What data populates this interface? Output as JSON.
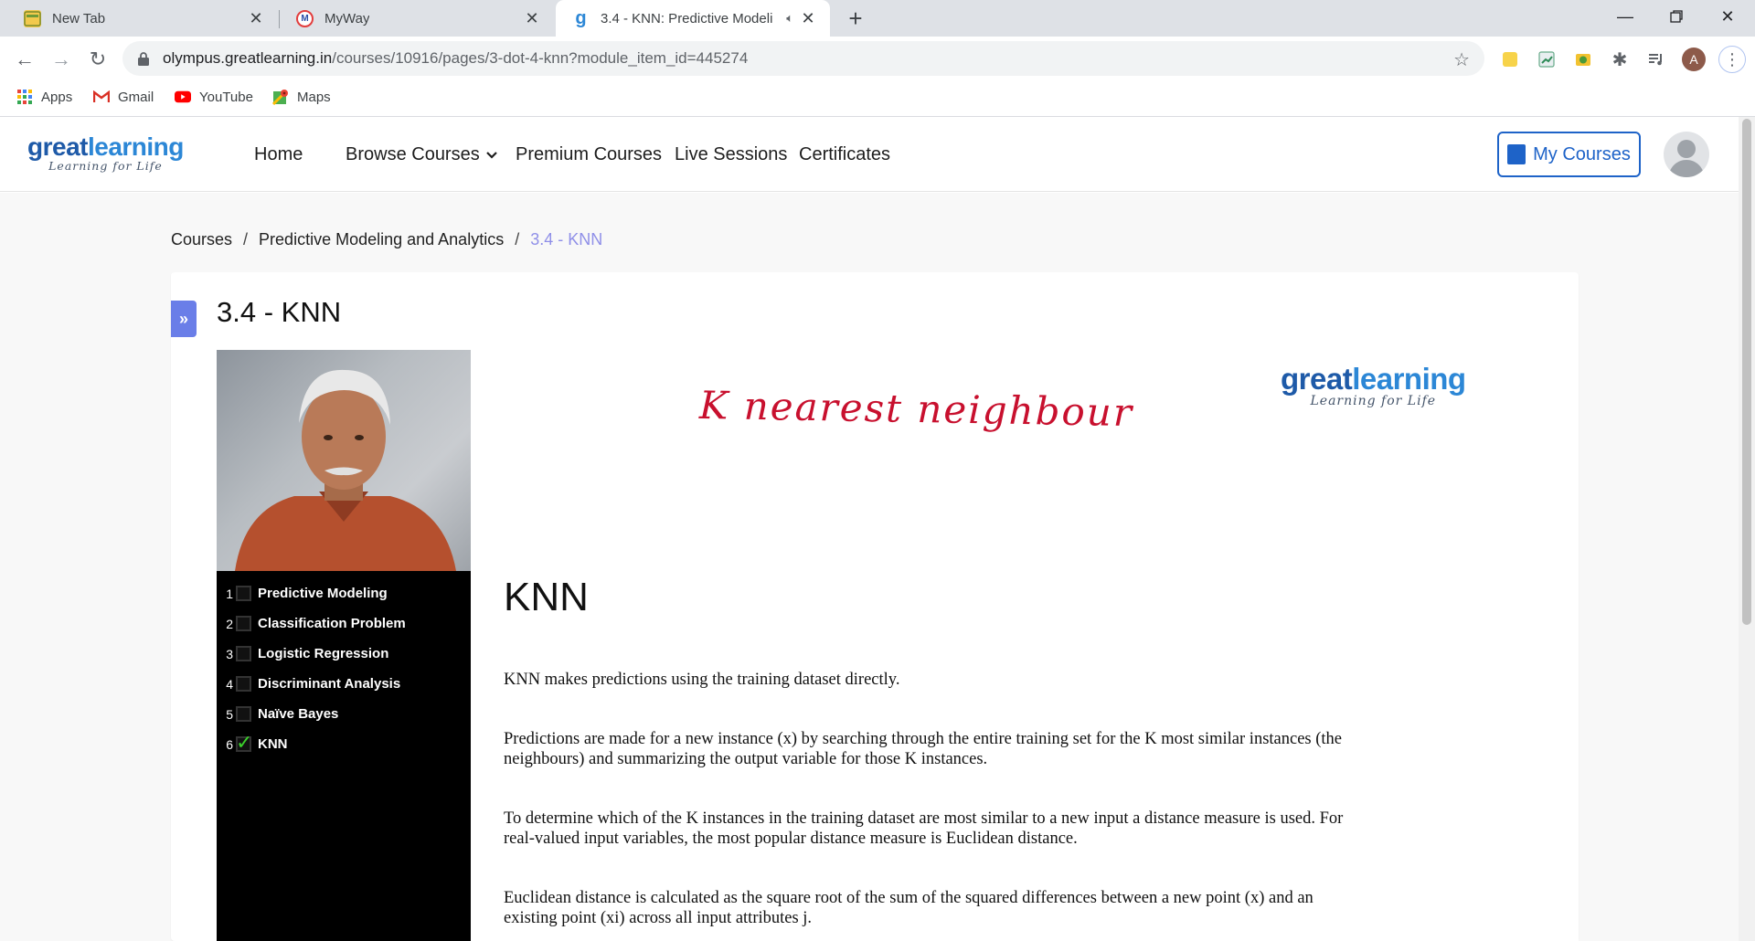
{
  "browser": {
    "tabs": [
      {
        "title": "New Tab",
        "active": false
      },
      {
        "title": "MyWay",
        "active": false
      },
      {
        "title": "3.4 - KNN: Predictive Modeli",
        "active": true
      }
    ],
    "url_host": "olympus.greatlearning.in",
    "url_path": "/courses/10916/pages/3-dot-4-knn?module_item_id=445274",
    "profile_initial": "A",
    "bookmarks": [
      "Apps",
      "Gmail",
      "YouTube",
      "Maps"
    ]
  },
  "site": {
    "logo_word1": "great",
    "logo_word2": "learning",
    "logo_tagline": "Learning for Life",
    "nav": [
      "Home",
      "Browse Courses",
      "Premium Courses",
      "Live Sessions",
      "Certificates"
    ],
    "my_courses_label": "My Courses"
  },
  "breadcrumb": {
    "items": [
      "Courses",
      "Predictive Modeling and Analytics"
    ],
    "current": "3.4 - KNN",
    "separator": "/"
  },
  "lesson": {
    "title": "3.4 - KNN",
    "expander_label": "»"
  },
  "video": {
    "toc": [
      {
        "num": "1",
        "label": "Predictive Modeling",
        "done": false
      },
      {
        "num": "2",
        "label": "Classification Problem",
        "done": false
      },
      {
        "num": "3",
        "label": "Logistic Regression",
        "done": false
      },
      {
        "num": "4",
        "label": "Discriminant Analysis",
        "done": false
      },
      {
        "num": "5",
        "label": "Naïve Bayes",
        "done": false
      },
      {
        "num": "6",
        "label": "KNN",
        "done": true
      }
    ],
    "handwriting": "K nearest neighbour",
    "slide_heading": "KNN",
    "paragraphs": [
      "KNN makes predictions using the training dataset directly.",
      "Predictions are made for a new instance (x) by searching through the entire training set for the K most similar instances (the neighbours) and summarizing  the output variable for those K instances.",
      "To determine which of the K instances in the training dataset are most similar to a new input a distance measure is used. For real-valued input variables, the most popular distance measure is Euclidean distance.",
      "Euclidean distance is calculated as the square root of the sum of the squared differences between a new point (x) and an existing point (xi) across all input attributes j."
    ]
  },
  "colors": {
    "accent_blue": "#1e63c8",
    "breadcrumb_current": "#8f8fe8",
    "expander": "#6a7ee8",
    "handwriting_red": "#c8102e",
    "check_green": "#3bd12b"
  }
}
